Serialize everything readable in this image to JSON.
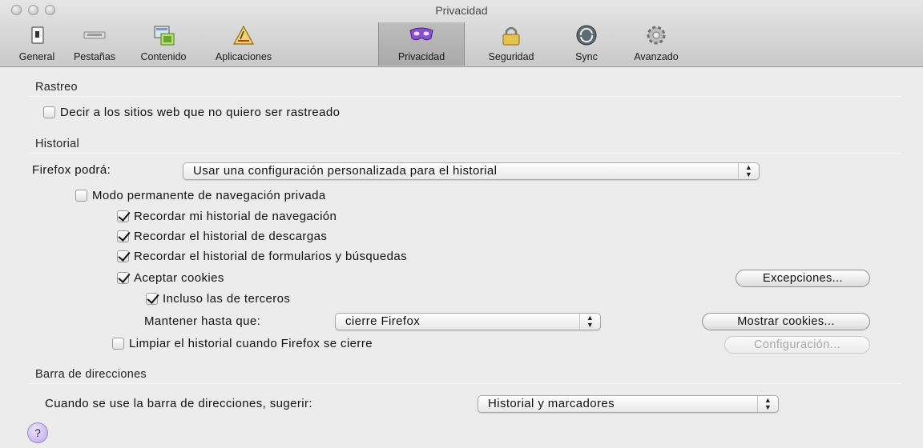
{
  "window": {
    "title": "Privacidad"
  },
  "toolbar": [
    {
      "label": "General",
      "icon": "general-icon"
    },
    {
      "label": "Pestañas",
      "icon": "tabs-icon"
    },
    {
      "label": "Contenido",
      "icon": "content-icon"
    },
    {
      "label": "Aplicaciones",
      "icon": "applications-icon"
    },
    {
      "label": "Privacidad",
      "icon": "privacy-mask-icon",
      "selected": true
    },
    {
      "label": "Seguridad",
      "icon": "padlock-icon"
    },
    {
      "label": "Sync",
      "icon": "sync-icon"
    },
    {
      "label": "Avanzado",
      "icon": "gear-icon"
    }
  ],
  "tracking": {
    "section": "Rastreo",
    "dnt_label": "Decir a los sitios web que no quiero ser rastreado",
    "dnt_checked": false
  },
  "history": {
    "section": "Historial",
    "mode_label": "Firefox podrá:",
    "mode_value": "Usar una configuración personalizada para el historial",
    "private_mode_label": "Modo permanente de navegación privada",
    "private_mode_checked": false,
    "remember_browsing_label": "Recordar mi historial de navegación",
    "remember_browsing_checked": true,
    "remember_downloads_label": "Recordar el historial de descargas",
    "remember_downloads_checked": true,
    "remember_forms_label": "Recordar el historial de formularios y búsquedas",
    "remember_forms_checked": true,
    "accept_cookies_label": "Aceptar cookies",
    "accept_cookies_checked": true,
    "exceptions_button": "Excepciones...",
    "third_party_label": "Incluso las de terceros",
    "third_party_checked": true,
    "keep_until_label": "Mantener hasta que:",
    "keep_until_value": "cierre Firefox",
    "show_cookies_button": "Mostrar cookies...",
    "clear_on_close_label": "Limpiar el historial cuando Firefox se cierre",
    "clear_on_close_checked": false,
    "settings_button": "Configuración..."
  },
  "location_bar": {
    "section": "Barra de direcciones",
    "suggest_label": "Cuando se use la barra de direcciones, sugerir:",
    "suggest_value": "Historial y marcadores"
  },
  "help": {
    "label": "?"
  },
  "colors": {
    "background": "#ececec",
    "toolbar": "#c9c9c9",
    "help_button": "#b9a4e6"
  }
}
